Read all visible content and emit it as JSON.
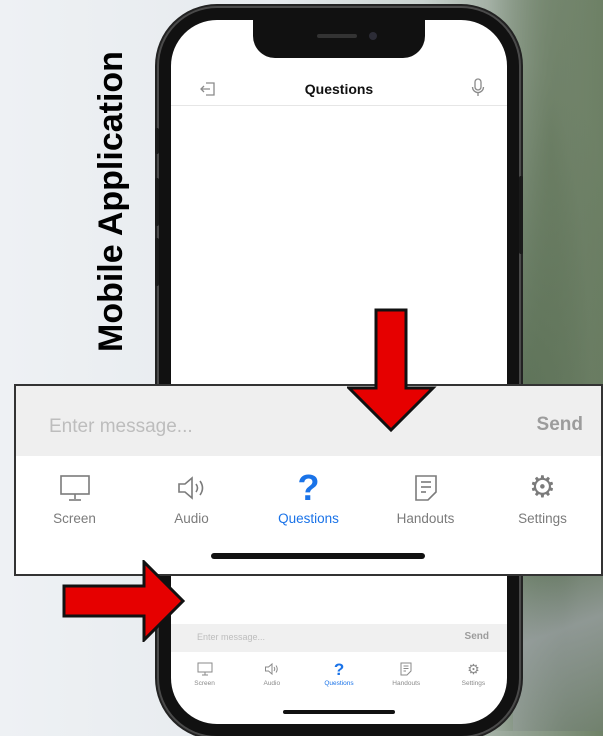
{
  "side_title": "Mobile Application",
  "header": {
    "title": "Questions"
  },
  "input": {
    "placeholder": "Enter message...",
    "send_label": "Send"
  },
  "tabs": [
    {
      "label": "Screen",
      "icon": "monitor-icon",
      "active": false
    },
    {
      "label": "Audio",
      "icon": "speaker-icon",
      "active": false
    },
    {
      "label": "Questions",
      "icon": "question-icon",
      "active": true
    },
    {
      "label": "Handouts",
      "icon": "document-icon",
      "active": false
    },
    {
      "label": "Settings",
      "icon": "gear-icon",
      "active": false
    }
  ],
  "colors": {
    "accent": "#1a73e8",
    "arrow": "#e60000",
    "inactive": "#7b7b7b"
  }
}
